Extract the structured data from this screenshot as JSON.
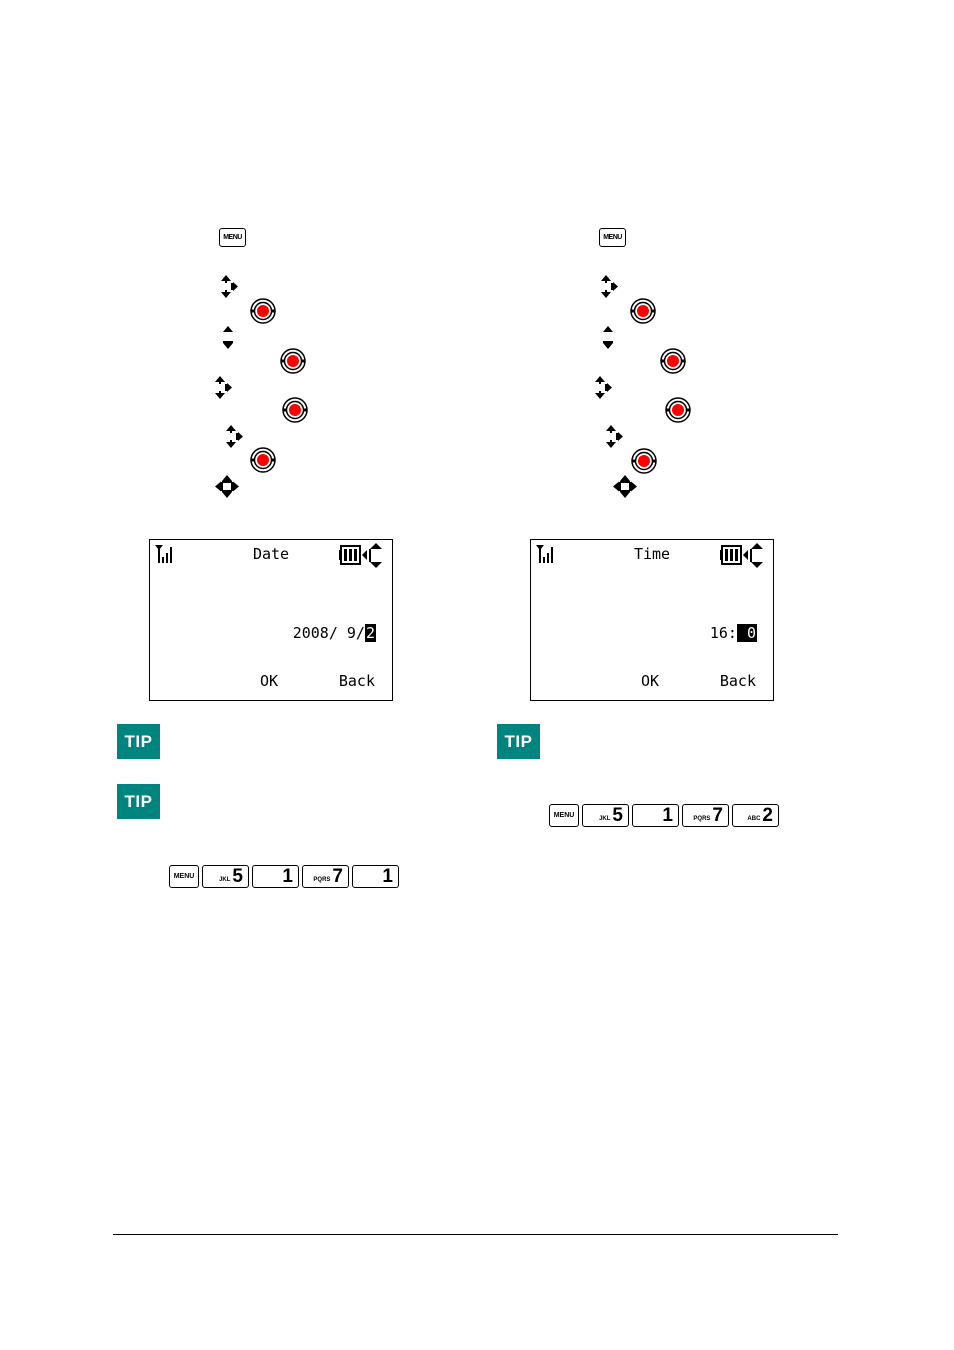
{
  "left_procedure": {
    "menu_key_label": "MENU",
    "steps": [
      {
        "icon": "nav-up-down-right-icon"
      },
      {
        "icon": "ok-button-icon"
      },
      {
        "icon": "nav-up-down-icon"
      },
      {
        "icon": "ok-button-icon"
      },
      {
        "icon": "nav-up-down-right-icon"
      },
      {
        "icon": "ok-button-icon"
      },
      {
        "icon": "nav-up-down-right-icon"
      },
      {
        "icon": "ok-button-icon"
      },
      {
        "icon": "nav-four-way-icon"
      }
    ],
    "screen": {
      "title": "Date",
      "value_prefix": "2008/ 9/",
      "value_highlight": "2",
      "softkey_left": "OK",
      "softkey_right": "Back"
    },
    "tips": [
      {
        "badge": "TIP"
      },
      {
        "badge": "TIP"
      }
    ],
    "key_sequence": [
      {
        "sub": "",
        "main": "MENU"
      },
      {
        "sub": "JKL",
        "main": "5"
      },
      {
        "sub": "",
        "main": "1"
      },
      {
        "sub": "PQRS",
        "main": "7"
      },
      {
        "sub": "",
        "main": "1"
      }
    ]
  },
  "right_procedure": {
    "menu_key_label": "MENU",
    "steps": [
      {
        "icon": "nav-up-down-right-icon"
      },
      {
        "icon": "ok-button-icon"
      },
      {
        "icon": "nav-up-down-icon"
      },
      {
        "icon": "ok-button-icon"
      },
      {
        "icon": "nav-up-down-right-icon"
      },
      {
        "icon": "ok-button-icon"
      },
      {
        "icon": "nav-up-down-right-icon"
      },
      {
        "icon": "ok-button-icon"
      },
      {
        "icon": "nav-four-way-icon"
      }
    ],
    "screen": {
      "title": "Time",
      "value_prefix": "16:",
      "value_highlight": " 0",
      "softkey_left": "OK",
      "softkey_right": "Back"
    },
    "tips": [
      {
        "badge": "TIP"
      }
    ],
    "key_sequence": [
      {
        "sub": "",
        "main": "MENU"
      },
      {
        "sub": "JKL",
        "main": "5"
      },
      {
        "sub": "",
        "main": "1"
      },
      {
        "sub": "PQRS",
        "main": "7"
      },
      {
        "sub": "ABC",
        "main": "2"
      }
    ]
  },
  "colors": {
    "tip_badge": "#00847f",
    "ok_button_center": "#ff0000"
  }
}
